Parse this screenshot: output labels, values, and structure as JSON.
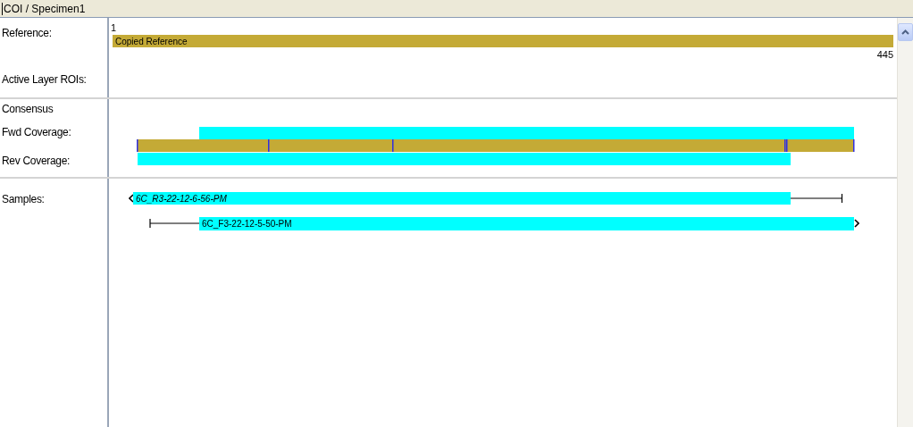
{
  "breadcrumb": "COI / Specimen1",
  "reference": {
    "label": "Reference:",
    "start": "1",
    "name": "Copied Reference",
    "end": "445"
  },
  "active_layer_rois": {
    "label": "Active Layer ROIs:"
  },
  "consensus": {
    "label": "Consensus",
    "fwd_label": "Fwd Coverage:",
    "rev_label": "Rev Coverage:"
  },
  "samples": {
    "label": "Samples:",
    "reads": [
      {
        "name": "6C_R3-22-12-6-56-PM",
        "kind": "reverse"
      },
      {
        "name": "6C_F3-22-12-5-50-PM",
        "kind": "forward"
      }
    ]
  }
}
